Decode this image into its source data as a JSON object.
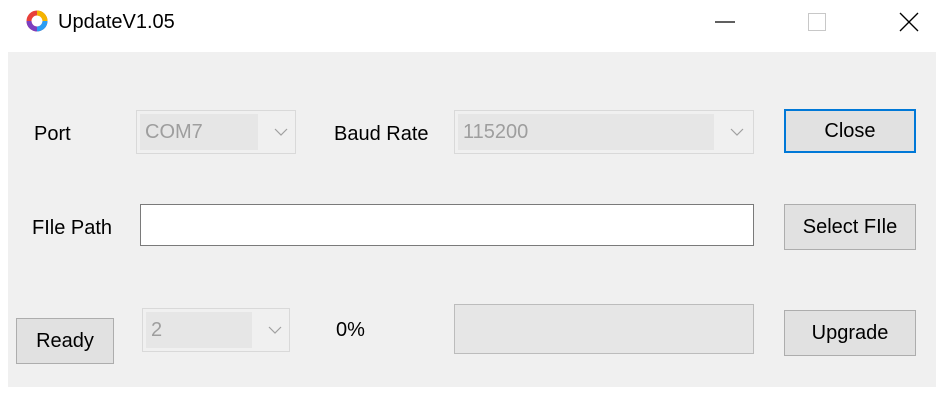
{
  "window": {
    "title": "UpdateV1.05",
    "app_icon": "ring-logo-icon",
    "controls": {
      "minimize": "minimize-icon",
      "maximize": "maximize-icon",
      "close": "close-icon"
    }
  },
  "port": {
    "label": "Port",
    "value": "COM7"
  },
  "baud_rate": {
    "label": "Baud Rate",
    "value": "115200"
  },
  "file_path": {
    "label": "FIle Path",
    "value": ""
  },
  "buttons": {
    "close": "Close",
    "select_file": "Select FIle",
    "ready": "Ready",
    "upgrade": "Upgrade"
  },
  "count_select": {
    "value": "2"
  },
  "progress": {
    "text": "0%",
    "value": 0
  },
  "colors": {
    "focus_border": "#0078d7",
    "disabled_text": "#9e9e9e",
    "client_bg": "#f0f0f0"
  }
}
